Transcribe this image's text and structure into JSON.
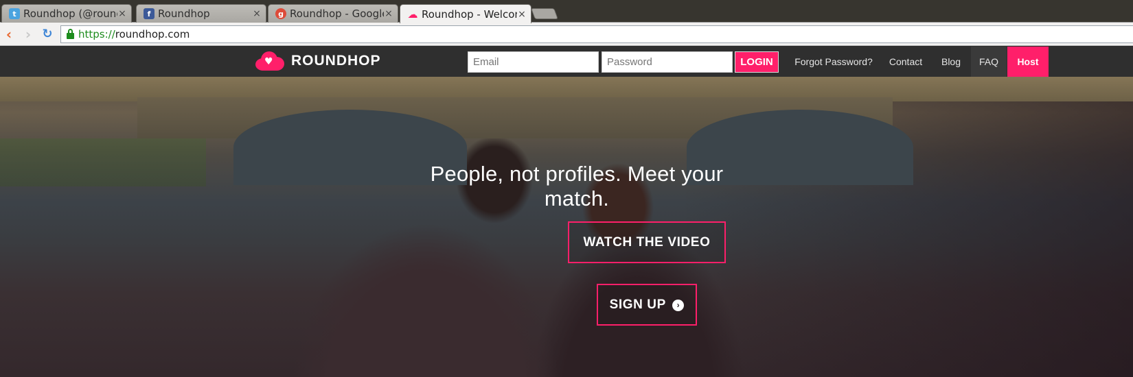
{
  "browser": {
    "tabs": [
      {
        "title": "Roundhop (@round",
        "icon": "twitter-icon",
        "color": "#4aa3df"
      },
      {
        "title": "Roundhop",
        "icon": "facebook-icon",
        "color": "#3b5998"
      },
      {
        "title": "Roundhop - Google+",
        "icon": "google-plus-icon",
        "color": "#dd4b39"
      },
      {
        "title": "Roundhop - Welcom",
        "icon": "roundhop-icon",
        "color": "#ff1f6a"
      }
    ],
    "close_glyph": "×",
    "url_scheme": "https://",
    "url_rest": "roundhop.com"
  },
  "site": {
    "brand": "ROUNDHOP",
    "accent": "#ff1f6a",
    "email_placeholder": "Email",
    "password_placeholder": "Password",
    "login_label": "LOGIN",
    "nav": {
      "forgot": "Forgot Password?",
      "contact": "Contact",
      "blog": "Blog",
      "faq": "FAQ",
      "host": "Host"
    },
    "headline": "People, not profiles. Meet your match.",
    "watch_label": "WATCH THE VIDEO",
    "signup_label": "SIGN UP"
  }
}
